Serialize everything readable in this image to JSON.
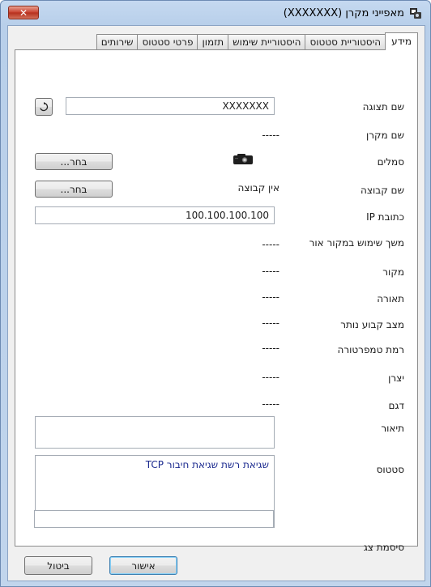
{
  "window": {
    "title": "מאפייני מקרן (XXXXXXX)",
    "close_label": "✕"
  },
  "tabs": [
    {
      "label": "מידע",
      "active": true
    },
    {
      "label": "היסטוריית סטטוס",
      "active": false
    },
    {
      "label": "היסטוריית שימוש",
      "active": false
    },
    {
      "label": "תזמון",
      "active": false
    },
    {
      "label": "פרטי סטטוס",
      "active": false
    },
    {
      "label": "שירותים",
      "active": false
    }
  ],
  "info": {
    "display_name": {
      "label": "שם תצוגה",
      "value": "XXXXXXX"
    },
    "projector_name": {
      "label": "שם מקרן",
      "value": "-----"
    },
    "icons": {
      "label": "סמלים",
      "button": "בחר..."
    },
    "group_name": {
      "label": "שם קבוצה",
      "value": "אין קבוצה",
      "button": "בחר..."
    },
    "ip_address": {
      "label": "כתובת IP",
      "value": "100.100.100.100"
    },
    "lamp_hours": {
      "label": "משך שימוש במקור אור",
      "value": "-----"
    },
    "source": {
      "label": "מקור",
      "value": "-----"
    },
    "lighting": {
      "label": "תאורה",
      "value": "-----"
    },
    "shutter_status": {
      "label": "מצב קבוע נותר",
      "value": "-----"
    },
    "temperature_level": {
      "label": "רמת טמפרטורה",
      "value": "-----"
    },
    "manufacturer": {
      "label": "יצרן",
      "value": "-----"
    },
    "model": {
      "label": "דגם",
      "value": "-----"
    },
    "description": {
      "label": "תיאור",
      "value": ""
    },
    "status": {
      "label": "סטטוס",
      "value": "שגיאת רשת שגיאת חיבור TCP"
    },
    "display_password": {
      "label": "סיסמת צג",
      "value": ""
    }
  },
  "footer": {
    "ok_label": "אישור",
    "cancel_label": "ביטול"
  },
  "icons": {
    "app": "projector-properties-icon",
    "refresh": "refresh-icon",
    "projector": "projector-icon"
  },
  "colors": {
    "status_text": "#1b2a8f",
    "close_button": "#c8402e"
  }
}
